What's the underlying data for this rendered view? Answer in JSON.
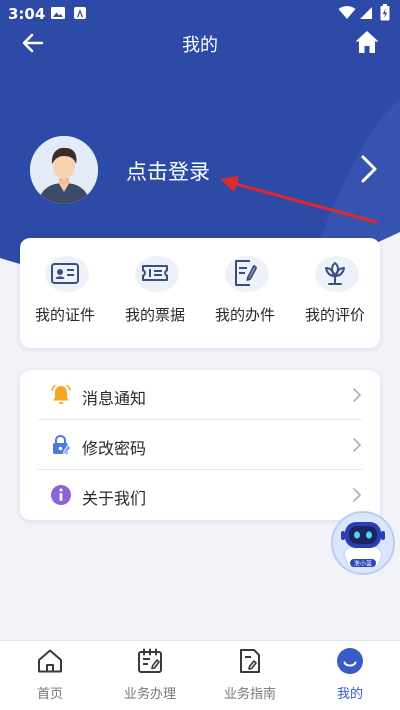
{
  "status_bar": {
    "time": "3:04"
  },
  "header": {
    "title": "我的"
  },
  "profile": {
    "login_label": "点击登录"
  },
  "quick_actions": [
    {
      "label": "我的证件",
      "icon": "id-card-icon"
    },
    {
      "label": "我的票据",
      "icon": "ticket-icon"
    },
    {
      "label": "我的办件",
      "icon": "document-edit-icon"
    },
    {
      "label": "我的评价",
      "icon": "flower-icon"
    }
  ],
  "menu": [
    {
      "label": "消息通知",
      "icon": "bell-icon"
    },
    {
      "label": "修改密码",
      "icon": "lock-edit-icon"
    },
    {
      "label": "关于我们",
      "icon": "info-icon"
    }
  ],
  "assistant": {
    "label": "准小蓝"
  },
  "tabs": [
    {
      "label": "首页",
      "icon": "home-icon"
    },
    {
      "label": "业务办理",
      "icon": "calendar-task-icon"
    },
    {
      "label": "业务指南",
      "icon": "guide-icon"
    },
    {
      "label": "我的",
      "icon": "profile-icon",
      "active": true
    }
  ],
  "colors": {
    "primary": "#2d4aa6",
    "accent": "#3a5bc7",
    "annotation": "#e0282e"
  }
}
